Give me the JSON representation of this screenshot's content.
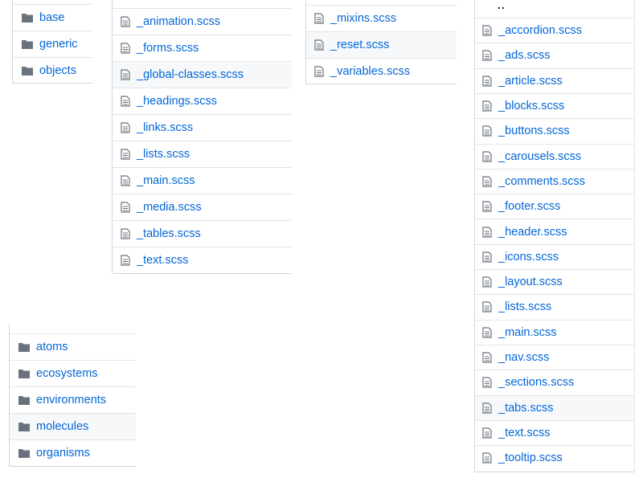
{
  "panels": {
    "folders_top": {
      "items": [
        {
          "label": "base",
          "icon": "folder-icon"
        },
        {
          "label": "generic",
          "icon": "folder-icon"
        },
        {
          "label": "objects",
          "icon": "folder-icon"
        }
      ]
    },
    "files_a": {
      "items": [
        {
          "label": "_animation.scss",
          "icon": "file-icon"
        },
        {
          "label": "_forms.scss",
          "icon": "file-icon"
        },
        {
          "label": "_global-classes.scss",
          "icon": "file-icon",
          "highlighted": true
        },
        {
          "label": "_headings.scss",
          "icon": "file-icon"
        },
        {
          "label": "_links.scss",
          "icon": "file-icon"
        },
        {
          "label": "_lists.scss",
          "icon": "file-icon"
        },
        {
          "label": "_main.scss",
          "icon": "file-icon"
        },
        {
          "label": "_media.scss",
          "icon": "file-icon"
        },
        {
          "label": "_tables.scss",
          "icon": "file-icon"
        },
        {
          "label": "_text.scss",
          "icon": "file-icon"
        }
      ]
    },
    "files_b": {
      "items": [
        {
          "label": "_mixins.scss",
          "icon": "file-icon"
        },
        {
          "label": "_reset.scss",
          "icon": "file-icon",
          "highlighted": true
        },
        {
          "label": "_variables.scss",
          "icon": "file-icon"
        }
      ]
    },
    "files_c": {
      "parent_label": "..",
      "items": [
        {
          "label": "_accordion.scss",
          "icon": "file-icon"
        },
        {
          "label": "_ads.scss",
          "icon": "file-icon"
        },
        {
          "label": "_article.scss",
          "icon": "file-icon"
        },
        {
          "label": "_blocks.scss",
          "icon": "file-icon"
        },
        {
          "label": "_buttons.scss",
          "icon": "file-icon"
        },
        {
          "label": "_carousels.scss",
          "icon": "file-icon"
        },
        {
          "label": "_comments.scss",
          "icon": "file-icon"
        },
        {
          "label": "_footer.scss",
          "icon": "file-icon"
        },
        {
          "label": "_header.scss",
          "icon": "file-icon"
        },
        {
          "label": "_icons.scss",
          "icon": "file-icon"
        },
        {
          "label": "_layout.scss",
          "icon": "file-icon"
        },
        {
          "label": "_lists.scss",
          "icon": "file-icon"
        },
        {
          "label": "_main.scss",
          "icon": "file-icon"
        },
        {
          "label": "_nav.scss",
          "icon": "file-icon"
        },
        {
          "label": "_sections.scss",
          "icon": "file-icon"
        },
        {
          "label": "_tabs.scss",
          "icon": "file-icon",
          "highlighted": true
        },
        {
          "label": "_text.scss",
          "icon": "file-icon"
        },
        {
          "label": "_tooltip.scss",
          "icon": "file-icon"
        }
      ]
    },
    "folders_bottom": {
      "items": [
        {
          "label": "atoms",
          "icon": "folder-icon"
        },
        {
          "label": "ecosystems",
          "icon": "folder-icon"
        },
        {
          "label": "environments",
          "icon": "folder-icon"
        },
        {
          "label": "molecules",
          "icon": "folder-icon",
          "highlighted": true
        },
        {
          "label": "organisms",
          "icon": "folder-icon"
        }
      ]
    }
  },
  "colors": {
    "link": "#0366d6",
    "icon": "#6a737d",
    "folder_icon": "#79b8ff",
    "row_highlight": "#f6f8fa",
    "border": "#e1e4e8"
  }
}
